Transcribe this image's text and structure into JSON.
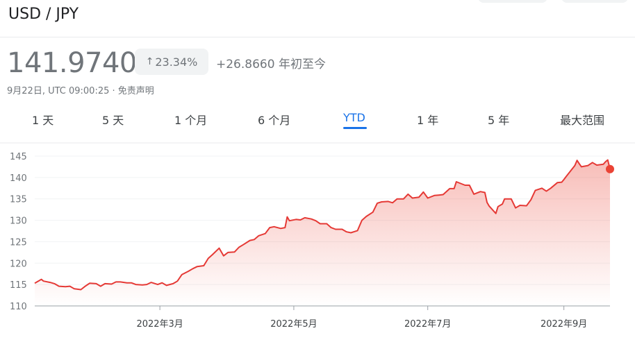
{
  "pair": "USD / JPY",
  "price": "141.9740",
  "change_pct": "23.34%",
  "change_abs": "+26.8660 年初至今",
  "timestamp": "9月22日, UTC 09:00:25 · 免责声明",
  "icons": {
    "change_arrow": "arrow-up-icon"
  },
  "colors": {
    "line": "#e53935",
    "active_tab": "#1a73e8",
    "last_point": "#ea4335"
  },
  "tabs": [
    {
      "label": "1 天"
    },
    {
      "label": "5 天"
    },
    {
      "label": "1 个月"
    },
    {
      "label": "6 个月"
    },
    {
      "label": "YTD",
      "active": true
    },
    {
      "label": "1 年"
    },
    {
      "label": "5 年"
    },
    {
      "label": "最大范围"
    }
  ],
  "chart_data": {
    "type": "area",
    "x_start": "2022-01-03",
    "x_end": "2022-09-22",
    "ylim": [
      110,
      145
    ],
    "yticks": [
      110,
      115,
      120,
      125,
      130,
      135,
      140,
      145
    ],
    "xticks": [
      {
        "label": "2022年3月",
        "date": "2022-03-01"
      },
      {
        "label": "2022年5月",
        "date": "2022-05-01"
      },
      {
        "label": "2022年7月",
        "date": "2022-07-01"
      },
      {
        "label": "2022年9月",
        "date": "2022-09-01"
      }
    ],
    "grid": true,
    "series": [
      {
        "points": [
          [
            "2022-01-03",
            115.3
          ],
          [
            "2022-01-04",
            115.6
          ],
          [
            "2022-01-05",
            115.9
          ],
          [
            "2022-01-06",
            116.2
          ],
          [
            "2022-01-07",
            115.8
          ],
          [
            "2022-01-10",
            115.5
          ],
          [
            "2022-01-12",
            115.2
          ],
          [
            "2022-01-14",
            114.6
          ],
          [
            "2022-01-17",
            114.5
          ],
          [
            "2022-01-19",
            114.6
          ],
          [
            "2022-01-21",
            114.0
          ],
          [
            "2022-01-24",
            113.8
          ],
          [
            "2022-01-26",
            114.6
          ],
          [
            "2022-01-28",
            115.3
          ],
          [
            "2022-01-31",
            115.2
          ],
          [
            "2022-02-02",
            114.6
          ],
          [
            "2022-02-04",
            115.2
          ],
          [
            "2022-02-07",
            115.1
          ],
          [
            "2022-02-09",
            115.6
          ],
          [
            "2022-02-11",
            115.6
          ],
          [
            "2022-02-14",
            115.4
          ],
          [
            "2022-02-16",
            115.4
          ],
          [
            "2022-02-18",
            115.0
          ],
          [
            "2022-02-21",
            114.9
          ],
          [
            "2022-02-23",
            115.0
          ],
          [
            "2022-02-25",
            115.5
          ],
          [
            "2022-02-28",
            115.0
          ],
          [
            "2022-03-02",
            115.4
          ],
          [
            "2022-03-04",
            114.8
          ],
          [
            "2022-03-07",
            115.2
          ],
          [
            "2022-03-09",
            115.8
          ],
          [
            "2022-03-11",
            117.3
          ],
          [
            "2022-03-14",
            118.1
          ],
          [
            "2022-03-16",
            118.7
          ],
          [
            "2022-03-18",
            119.2
          ],
          [
            "2022-03-21",
            119.4
          ],
          [
            "2022-03-23",
            121.1
          ],
          [
            "2022-03-25",
            122.0
          ],
          [
            "2022-03-28",
            123.5
          ],
          [
            "2022-03-30",
            121.7
          ],
          [
            "2022-04-01",
            122.5
          ],
          [
            "2022-04-04",
            122.6
          ],
          [
            "2022-04-06",
            123.7
          ],
          [
            "2022-04-08",
            124.3
          ],
          [
            "2022-04-11",
            125.3
          ],
          [
            "2022-04-13",
            125.5
          ],
          [
            "2022-04-15",
            126.4
          ],
          [
            "2022-04-18",
            126.9
          ],
          [
            "2022-04-20",
            128.3
          ],
          [
            "2022-04-22",
            128.5
          ],
          [
            "2022-04-25",
            128.1
          ],
          [
            "2022-04-27",
            128.3
          ],
          [
            "2022-04-28",
            130.8
          ],
          [
            "2022-04-29",
            129.9
          ],
          [
            "2022-05-02",
            130.2
          ],
          [
            "2022-05-04",
            130.1
          ],
          [
            "2022-05-06",
            130.6
          ],
          [
            "2022-05-09",
            130.3
          ],
          [
            "2022-05-11",
            129.9
          ],
          [
            "2022-05-13",
            129.2
          ],
          [
            "2022-05-16",
            129.2
          ],
          [
            "2022-05-18",
            128.3
          ],
          [
            "2022-05-20",
            127.9
          ],
          [
            "2022-05-23",
            127.9
          ],
          [
            "2022-05-25",
            127.3
          ],
          [
            "2022-05-27",
            127.1
          ],
          [
            "2022-05-30",
            127.6
          ],
          [
            "2022-06-01",
            130.0
          ],
          [
            "2022-06-03",
            130.9
          ],
          [
            "2022-06-06",
            131.9
          ],
          [
            "2022-06-08",
            134.0
          ],
          [
            "2022-06-10",
            134.3
          ],
          [
            "2022-06-13",
            134.4
          ],
          [
            "2022-06-15",
            134.1
          ],
          [
            "2022-06-17",
            135.0
          ],
          [
            "2022-06-20",
            135.0
          ],
          [
            "2022-06-22",
            136.1
          ],
          [
            "2022-06-24",
            135.2
          ],
          [
            "2022-06-27",
            135.4
          ],
          [
            "2022-06-29",
            136.6
          ],
          [
            "2022-07-01",
            135.2
          ],
          [
            "2022-07-04",
            135.8
          ],
          [
            "2022-07-06",
            135.9
          ],
          [
            "2022-07-08",
            136.0
          ],
          [
            "2022-07-11",
            137.4
          ],
          [
            "2022-07-13",
            137.4
          ],
          [
            "2022-07-14",
            139.0
          ],
          [
            "2022-07-18",
            138.2
          ],
          [
            "2022-07-20",
            138.2
          ],
          [
            "2022-07-22",
            136.1
          ],
          [
            "2022-07-25",
            136.7
          ],
          [
            "2022-07-27",
            136.5
          ],
          [
            "2022-07-28",
            134.2
          ],
          [
            "2022-07-29",
            133.3
          ],
          [
            "2022-08-01",
            131.6
          ],
          [
            "2022-08-02",
            133.2
          ],
          [
            "2022-08-04",
            133.8
          ],
          [
            "2022-08-05",
            135.0
          ],
          [
            "2022-08-08",
            135.0
          ],
          [
            "2022-08-10",
            132.9
          ],
          [
            "2022-08-12",
            133.5
          ],
          [
            "2022-08-15",
            133.4
          ],
          [
            "2022-08-17",
            134.8
          ],
          [
            "2022-08-19",
            137.0
          ],
          [
            "2022-08-22",
            137.5
          ],
          [
            "2022-08-24",
            136.8
          ],
          [
            "2022-08-26",
            137.5
          ],
          [
            "2022-08-29",
            138.8
          ],
          [
            "2022-08-31",
            138.9
          ],
          [
            "2022-09-01",
            139.5
          ],
          [
            "2022-09-02",
            140.2
          ],
          [
            "2022-09-06",
            142.8
          ],
          [
            "2022-09-07",
            144.0
          ],
          [
            "2022-09-08",
            143.2
          ],
          [
            "2022-09-09",
            142.5
          ],
          [
            "2022-09-12",
            142.8
          ],
          [
            "2022-09-14",
            143.5
          ],
          [
            "2022-09-16",
            142.9
          ],
          [
            "2022-09-19",
            143.1
          ],
          [
            "2022-09-20",
            143.7
          ],
          [
            "2022-09-21",
            144.1
          ],
          [
            "2022-09-22",
            141.97
          ]
        ]
      }
    ]
  }
}
